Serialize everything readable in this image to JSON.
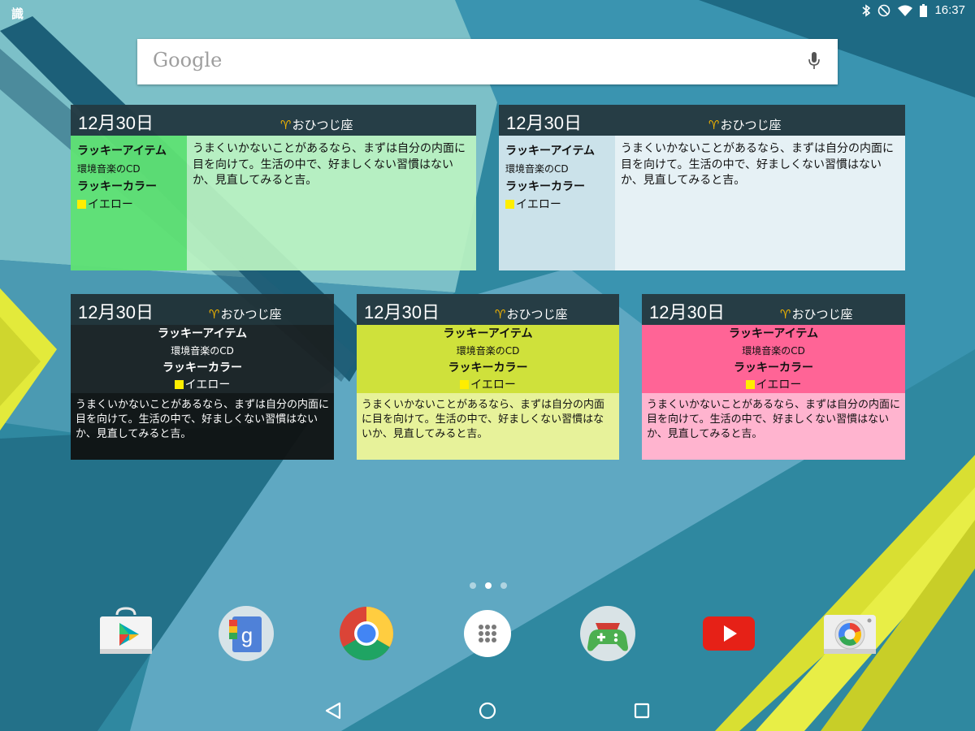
{
  "status_bar": {
    "notification_glyph": "識",
    "icons": [
      "bluetooth-icon",
      "do-not-disturb-icon",
      "wifi-icon",
      "battery-icon"
    ],
    "time": "16:37"
  },
  "search_bar": {
    "logo": "Google",
    "icon": "mic-icon"
  },
  "widget_common": {
    "date": "12月30日",
    "sign_glyph": "♈",
    "sign": "おひつじ座",
    "lucky_item_label": "ラッキーアイテム",
    "lucky_item": "環境音楽のCD",
    "lucky_color_label": "ラッキーカラー",
    "lucky_color": "イエロー",
    "fortune": "うまくいかないことがあるなら、まずは自分の内面に目を向けて。生活の中で、好ましくない習慣はないか、見直してみると吉。"
  },
  "widgets": [
    {
      "name": "green",
      "header": "#263d45",
      "left": "#6ae47c",
      "right": "#b7f1bf"
    },
    {
      "name": "white",
      "header": "#263d45",
      "left": "#cbe2ea",
      "right": "#e6f1f5"
    },
    {
      "name": "black",
      "header": "#203036",
      "left": "#1a1e1f",
      "right": "#121515"
    },
    {
      "name": "lime",
      "header": "#263d45",
      "left": "#cfe13b",
      "right": "#e7f29a"
    },
    {
      "name": "pink",
      "header": "#263d45",
      "left": "#ff6496",
      "right": "#ffb4cf"
    }
  ],
  "page_indicator": {
    "pages": 3,
    "active": 2
  },
  "dock": {
    "apps": [
      "play-store-icon",
      "google-icon",
      "chrome-icon",
      "app-drawer-icon",
      "play-games-icon",
      "youtube-icon",
      "camera-icon"
    ]
  },
  "nav_bar": {
    "buttons": [
      "back-icon",
      "home-icon",
      "recents-icon"
    ]
  },
  "colors": {
    "accent_yellow": "#ffee00",
    "sign_gold": "#f2b400"
  }
}
